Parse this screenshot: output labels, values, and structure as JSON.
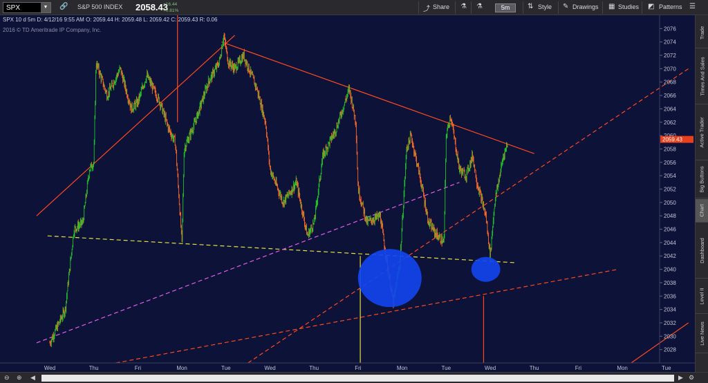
{
  "toolbar": {
    "symbol": "SPX",
    "chart_label": "SPX 10 d 5m",
    "index_name": "S&P 500 INDEX",
    "last_price": "2058.43",
    "change": "+16.44",
    "change_pct": "+0.81%",
    "share": "Share",
    "timeframe": "5m",
    "style": "Style",
    "drawings": "Drawings",
    "studies": "Studies",
    "patterns": "Patterns"
  },
  "info": {
    "line": "SPX 10 d 5m   D: 4/12/16 9:55 AM   O: 2059.44   H: 2059.48   L: 2059.42   C: 2059.43   R: 0.06",
    "copyright": "2016 © TD Ameritrade IP Company, Inc."
  },
  "right_tabs": [
    "Trade",
    "Times And Sales",
    "Active Trader",
    "Big Buttons",
    "Chart",
    "Dashboard",
    "Level II",
    "Live News"
  ],
  "colors": {
    "background": "#0d1238",
    "up_candle": "#22c72a",
    "down_candle": "#ff6a2a",
    "trendline_red": "#ff4a20",
    "support_yellow": "#e8e040",
    "trend_magenta": "#e060e8",
    "marker_blue": "#1144ee",
    "price_label": "#e8401c"
  },
  "chart_data": {
    "type": "candlestick",
    "title": "SPX 10 d 5m",
    "ylim": [
      2026,
      2078
    ],
    "y_ticks": [
      2028,
      2030,
      2032,
      2034,
      2036,
      2038,
      2040,
      2042,
      2044,
      2046,
      2048,
      2050,
      2052,
      2054,
      2056,
      2058,
      2060,
      2062,
      2064,
      2066,
      2068,
      2070,
      2072,
      2074,
      2076
    ],
    "x_ticks": [
      "Wed",
      "Thu",
      "Fri",
      "Mon",
      "Tue",
      "Wed",
      "Thu",
      "Fri",
      "Mon",
      "Tue",
      "Wed",
      "Thu",
      "Fri",
      "Mon",
      "Tue"
    ],
    "current_price": "2059.43",
    "price_path": [
      [
        0,
        2029
      ],
      [
        0.35,
        2034
      ],
      [
        0.55,
        2046
      ],
      [
        0.75,
        2047
      ],
      [
        0.9,
        2055
      ],
      [
        1.0,
        2056
      ],
      [
        1.05,
        2071
      ],
      [
        1.3,
        2066
      ],
      [
        1.6,
        2070
      ],
      [
        1.85,
        2064
      ],
      [
        2.0,
        2065
      ],
      [
        2.2,
        2069
      ],
      [
        2.5,
        2065
      ],
      [
        2.7,
        2061
      ],
      [
        2.85,
        2059
      ],
      [
        3.0,
        2044
      ],
      [
        3.05,
        2058
      ],
      [
        3.3,
        2062
      ],
      [
        3.6,
        2068
      ],
      [
        3.85,
        2071
      ],
      [
        3.95,
        2075
      ],
      [
        4.05,
        2071
      ],
      [
        4.2,
        2070
      ],
      [
        4.4,
        2072
      ],
      [
        4.7,
        2067
      ],
      [
        4.9,
        2062
      ],
      [
        5.0,
        2055
      ],
      [
        5.3,
        2050
      ],
      [
        5.6,
        2053
      ],
      [
        5.85,
        2045
      ],
      [
        6.0,
        2047
      ],
      [
        6.2,
        2057
      ],
      [
        6.5,
        2061
      ],
      [
        6.8,
        2067
      ],
      [
        6.95,
        2062
      ],
      [
        7.0,
        2052
      ],
      [
        7.2,
        2047
      ],
      [
        7.5,
        2048
      ],
      [
        7.7,
        2039
      ],
      [
        7.8,
        2035
      ],
      [
        7.95,
        2041
      ],
      [
        8.1,
        2058
      ],
      [
        8.2,
        2060
      ],
      [
        8.4,
        2054
      ],
      [
        8.6,
        2047
      ],
      [
        8.8,
        2045
      ],
      [
        8.95,
        2044
      ],
      [
        9.0,
        2060
      ],
      [
        9.1,
        2063
      ],
      [
        9.3,
        2055
      ],
      [
        9.45,
        2054
      ],
      [
        9.6,
        2057
      ],
      [
        9.7,
        2053
      ],
      [
        9.9,
        2048
      ],
      [
        10.0,
        2042
      ],
      [
        10.1,
        2050
      ],
      [
        10.3,
        2057
      ],
      [
        10.4,
        2059
      ]
    ],
    "trendlines": [
      {
        "style": "solid",
        "color": "red",
        "from": [
          -0.3,
          2048
        ],
        "to": [
          4.2,
          2075
        ]
      },
      {
        "style": "solid",
        "color": "red",
        "from": [
          3.9,
          2074
        ],
        "to": [
          11.0,
          2057.3
        ]
      },
      {
        "style": "dashed",
        "color": "yellow",
        "from": [
          -0.05,
          2045
        ],
        "to": [
          10.55,
          2041
        ]
      },
      {
        "style": "dashed",
        "color": "magenta",
        "from": [
          -0.3,
          2029
        ],
        "to": [
          9.3,
          2053
        ]
      },
      {
        "style": "dashed",
        "color": "red",
        "from": [
          4.5,
          2026
        ],
        "to": [
          14.5,
          2070
        ]
      },
      {
        "style": "dashed",
        "color": "red",
        "from": [
          1.5,
          2026
        ],
        "to": [
          12.9,
          2040
        ]
      },
      {
        "style": "solid",
        "color": "red",
        "from": [
          13.2,
          2026
        ],
        "to": [
          14.5,
          2032
        ]
      }
    ],
    "vertical_lines": [
      {
        "color": "red",
        "x": 2.9,
        "from": 2062,
        "to": 2078
      },
      {
        "color": "yellow",
        "x": 7.05,
        "from": 2026,
        "to": 2042
      },
      {
        "color": "red",
        "x": 9.85,
        "from": 2026,
        "to": 2036
      }
    ],
    "markers": [
      {
        "shape": "circle",
        "color": "blue",
        "x": 7.72,
        "y": 2038.7,
        "size": "large"
      },
      {
        "shape": "circle",
        "color": "blue",
        "x": 9.9,
        "y": 2040,
        "size": "small"
      }
    ]
  }
}
